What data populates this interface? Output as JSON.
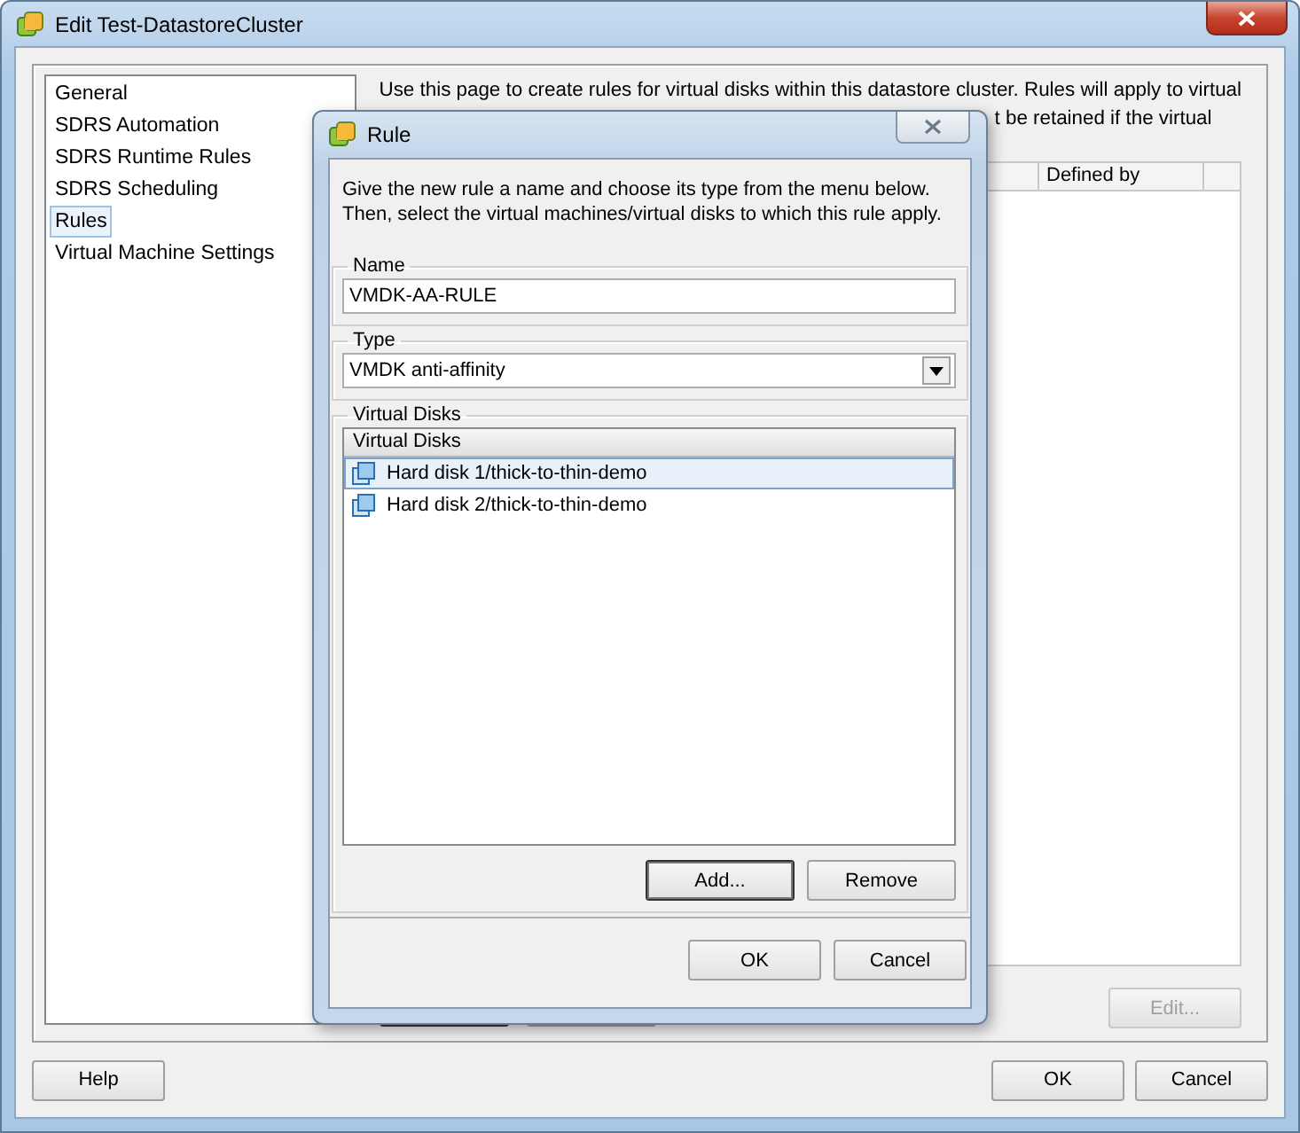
{
  "window": {
    "title": "Edit Test-DatastoreCluster"
  },
  "nav": {
    "items": [
      {
        "label": "General",
        "selected": false
      },
      {
        "label": "SDRS Automation",
        "selected": false
      },
      {
        "label": "SDRS Runtime Rules",
        "selected": false
      },
      {
        "label": "SDRS Scheduling",
        "selected": false
      },
      {
        "label": "Rules",
        "selected": true
      },
      {
        "label": "Virtual Machine Settings",
        "selected": false
      }
    ]
  },
  "description": [
    "Use this page to create rules for virtual disks within this datastore cluster. Rules will apply to virtual",
    "t be retained if the virtual"
  ],
  "rules_table": {
    "columns": [
      {
        "label": "Defined by"
      }
    ]
  },
  "edit_button": {
    "label": "Edit...",
    "disabled": true
  },
  "buttons": [
    {
      "label": "Help"
    },
    {
      "label": "OK"
    },
    {
      "label": "Cancel"
    }
  ],
  "dialog": {
    "title": "Rule",
    "instructions": [
      "Give the new rule a name and choose its type from the menu below.",
      "Then, select the virtual machines/virtual disks to which this rule apply."
    ],
    "name_group": {
      "legend": "Name",
      "value": "VMDK-AA-RULE"
    },
    "type_group": {
      "legend": "Type",
      "value": "VMDK anti-affinity"
    },
    "disks_group": {
      "legend": "Virtual Disks",
      "list_header": "Virtual Disks",
      "items": [
        {
          "label": "Hard disk 1/thick-to-thin-demo",
          "selected": true
        },
        {
          "label": "Hard disk 2/thick-to-thin-demo",
          "selected": false
        }
      ]
    },
    "disk_buttons": [
      {
        "label": "Add...",
        "focused": true
      },
      {
        "label": "Remove",
        "focused": false
      }
    ],
    "buttons": [
      {
        "label": "OK"
      },
      {
        "label": "Cancel"
      }
    ]
  }
}
